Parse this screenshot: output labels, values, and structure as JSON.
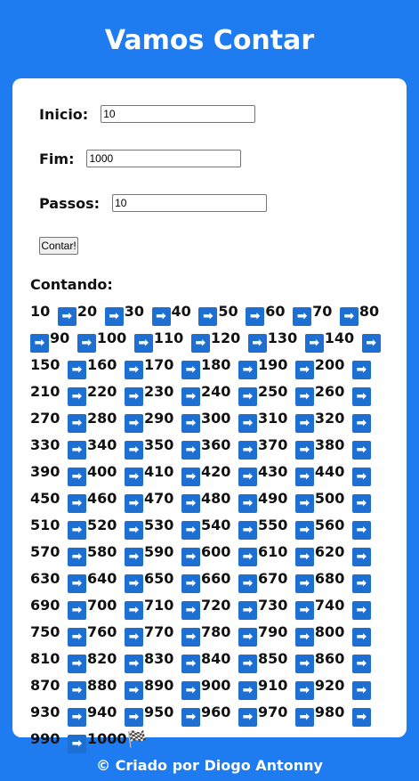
{
  "header": {
    "title": "Vamos Contar"
  },
  "form": {
    "inicio_label": "Inicio:",
    "inicio_value": "10",
    "fim_label": "Fim:",
    "fim_value": "1000",
    "passos_label": "Passos:",
    "passos_value": "10",
    "button_label": "Contar!"
  },
  "result": {
    "title": "Contando:",
    "start": "10",
    "arrow_icon": "➡",
    "flag_icon": "🏁",
    "items": [
      "20",
      "30",
      "40",
      "50",
      "60",
      "70",
      "80",
      "90",
      "100",
      "110",
      "120",
      "130",
      "140",
      "150",
      "160",
      "170",
      "180",
      "190",
      "200",
      "210",
      "220",
      "230",
      "240",
      "250",
      "260",
      "270",
      "280",
      "290",
      "300",
      "310",
      "320",
      "330",
      "340",
      "350",
      "360",
      "370",
      "380",
      "390",
      "400",
      "410",
      "420",
      "430",
      "440",
      "450",
      "460",
      "470",
      "480",
      "490",
      "500",
      "510",
      "520",
      "530",
      "540",
      "550",
      "560",
      "570",
      "580",
      "590",
      "600",
      "610",
      "620",
      "630",
      "640",
      "650",
      "660",
      "670",
      "680",
      "690",
      "700",
      "710",
      "720",
      "730",
      "740",
      "750",
      "760",
      "770",
      "780",
      "790",
      "800",
      "810",
      "820",
      "830",
      "840",
      "850",
      "860",
      "870",
      "880",
      "890",
      "900",
      "910",
      "920",
      "930",
      "940",
      "950",
      "960",
      "970",
      "980",
      "990",
      "1000"
    ]
  },
  "footer": {
    "text": "© Criado por Diogo Antonny"
  },
  "colors": {
    "background": "#1e7bf0",
    "card": "#ffffff",
    "arrow": "#1e6fd2"
  }
}
